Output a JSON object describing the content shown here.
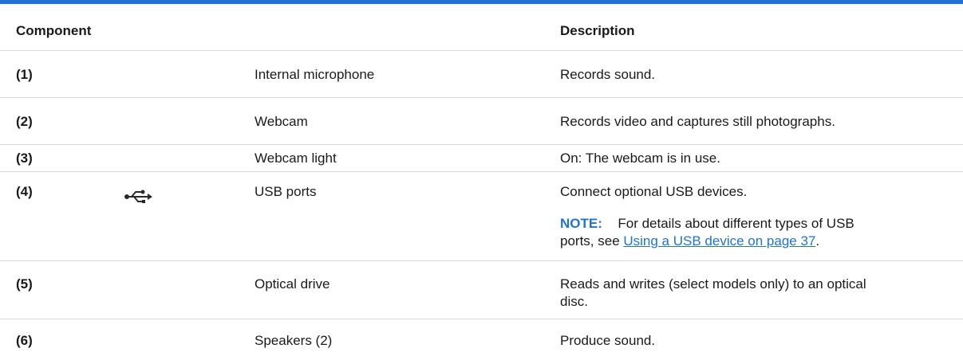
{
  "header": {
    "component": "Component",
    "description": "Description"
  },
  "rows": [
    {
      "num": "(1)",
      "name": "Internal microphone",
      "description": "Records sound."
    },
    {
      "num": "(2)",
      "name": "Webcam",
      "description": "Records video and captures still photographs."
    },
    {
      "num": "(3)",
      "name": "Webcam light",
      "description": "On: The webcam is in use."
    },
    {
      "num": "(4)",
      "icon": "usb-icon",
      "name": "USB ports",
      "description": "Connect optional USB devices.",
      "note_label": "NOTE:",
      "note_line1": "For details about different types of USB",
      "note_line2_prefix": "ports, see ",
      "note_link": "Using a USB device on page 37",
      "note_line2_suffix": "."
    },
    {
      "num": "(5)",
      "name": "Optical drive",
      "description_line1": "Reads and writes (select models only) to an optical",
      "description_line2": "disc."
    },
    {
      "num": "(6)",
      "name": "Speakers (2)",
      "description": "Produce sound."
    }
  ],
  "colors": {
    "accent": "#1f73d2",
    "rule": "#d8d8d8"
  }
}
